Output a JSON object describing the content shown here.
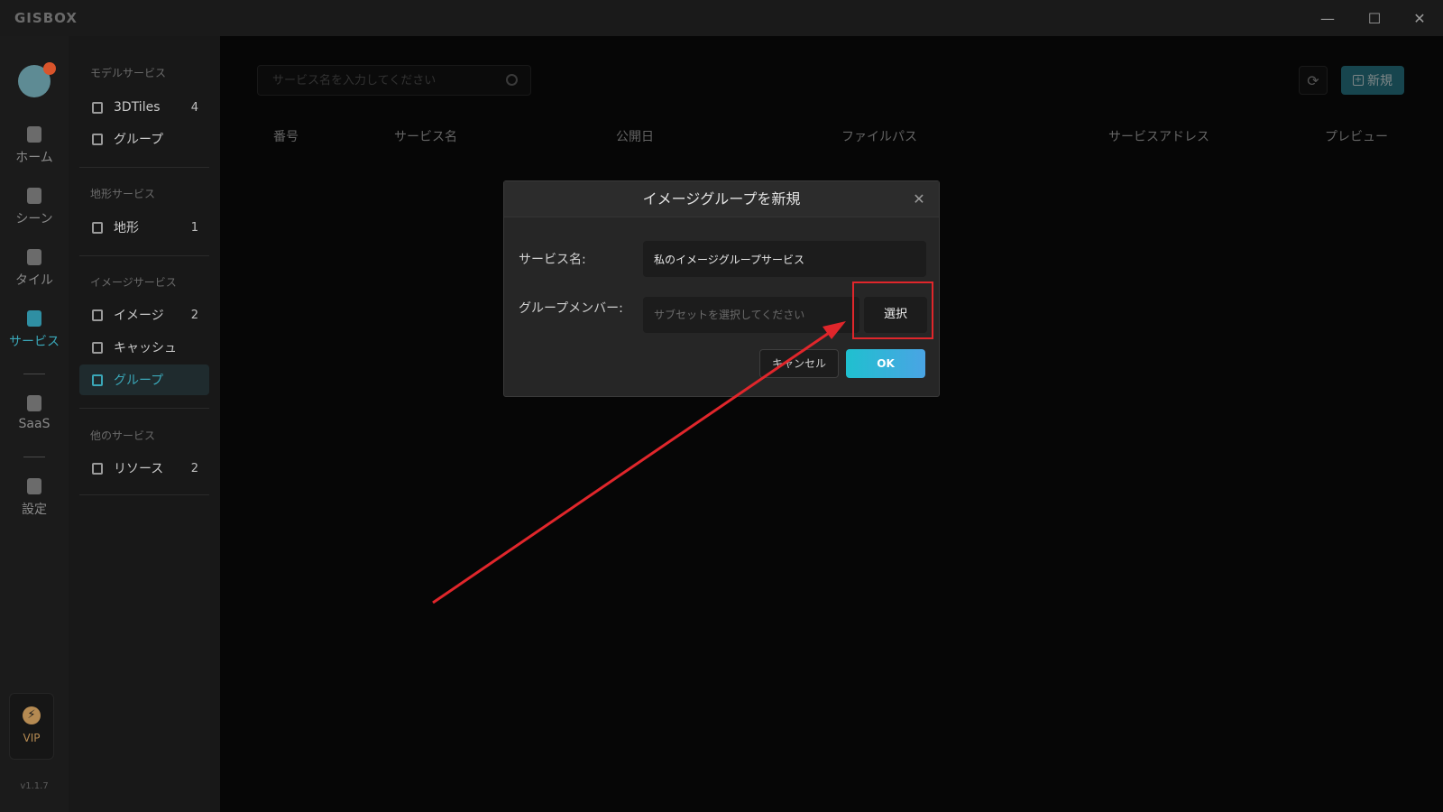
{
  "app": {
    "logo": "GISBOX"
  },
  "window_controls": {
    "minimize": "—",
    "maximize": "☐",
    "close": "✕"
  },
  "rail": {
    "items": [
      {
        "label": "ホーム"
      },
      {
        "label": "シーン"
      },
      {
        "label": "タイル"
      },
      {
        "label": "サービス"
      },
      {
        "label": "SaaS"
      },
      {
        "label": "設定"
      }
    ],
    "vip": "VIP",
    "version": "v1.1.7"
  },
  "sidebar": {
    "sections": [
      {
        "title": "モデルサービス",
        "items": [
          {
            "label": "3DTiles",
            "count": "4"
          },
          {
            "label": "グループ",
            "count": ""
          }
        ]
      },
      {
        "title": "地形サービス",
        "items": [
          {
            "label": "地形",
            "count": "1"
          }
        ]
      },
      {
        "title": "イメージサービス",
        "items": [
          {
            "label": "イメージ",
            "count": "2"
          },
          {
            "label": "キャッシュ",
            "count": ""
          },
          {
            "label": "グループ",
            "count": ""
          }
        ]
      },
      {
        "title": "他のサービス",
        "items": [
          {
            "label": "リソース",
            "count": "2"
          }
        ]
      }
    ]
  },
  "toolbar": {
    "search_placeholder": "サービス名を入力してください",
    "refresh_glyph": "⟳",
    "new_label": "新規",
    "new_glyph": "+"
  },
  "table": {
    "headers": [
      "番号",
      "サービス名",
      "公開日",
      "ファイルパス",
      "サービスアドレス",
      "プレビュー"
    ]
  },
  "modal": {
    "title": "イメージグループを新規",
    "close_glyph": "✕",
    "service_name_label": "サービス名:",
    "service_name_value": "私のイメージグループサービス",
    "members_label": "グループメンバー:",
    "members_placeholder": "サブセットを選択してください",
    "select_label": "選択",
    "cancel_label": "キャンセル",
    "ok_label": "OK"
  },
  "colors": {
    "accent": "#2a7f8f",
    "annotation_red": "#e0262b"
  }
}
